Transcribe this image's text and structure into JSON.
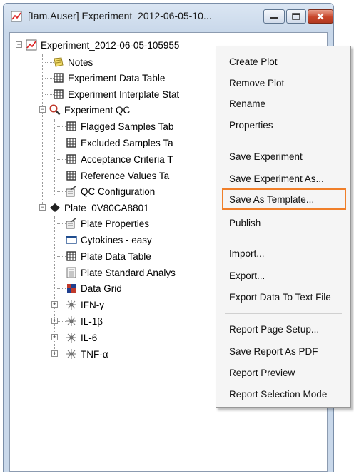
{
  "window": {
    "title": "[Iam.Auser] Experiment_2012-06-05-10..."
  },
  "tree": {
    "root": "Experiment_2012-06-05-105955",
    "items": [
      {
        "label": "Notes",
        "icon": "notes-icon"
      },
      {
        "label": "Experiment Data Table",
        "icon": "table-icon"
      },
      {
        "label": "Experiment Interplate Stat",
        "icon": "table-icon"
      },
      {
        "label": "Experiment QC",
        "icon": "magnifier-icon"
      },
      {
        "label": "Flagged Samples Tab",
        "icon": "table-icon"
      },
      {
        "label": "Excluded Samples Ta",
        "icon": "table-icon"
      },
      {
        "label": "Acceptance Criteria T",
        "icon": "table-icon"
      },
      {
        "label": "Reference Values Ta",
        "icon": "table-icon"
      },
      {
        "label": "QC Configuration",
        "icon": "configuration-icon"
      },
      {
        "label": "Plate_0V80CA8801",
        "icon": "plate-icon"
      },
      {
        "label": "Plate Properties",
        "icon": "configuration-icon"
      },
      {
        "label": "Cytokines - easy",
        "icon": "layout-icon"
      },
      {
        "label": "Plate Data Table",
        "icon": "table-icon"
      },
      {
        "label": "Plate Standard Analys",
        "icon": "analysis-icon"
      },
      {
        "label": "Data Grid",
        "icon": "grid-icon"
      },
      {
        "label": "IFN-γ",
        "icon": "analyte-icon"
      },
      {
        "label": "IL-1β",
        "icon": "analyte-icon"
      },
      {
        "label": "IL-6",
        "icon": "analyte-icon"
      },
      {
        "label": "TNF-α",
        "icon": "analyte-icon"
      }
    ]
  },
  "context_menu": {
    "items": [
      "Create Plot",
      "Remove Plot",
      "Rename",
      "Properties",
      "Save Experiment",
      "Save Experiment As...",
      "Save As Template...",
      "Publish",
      "Import...",
      "Export...",
      "Export Data To Text File",
      "Report Page Setup...",
      "Save Report As PDF",
      "Report Preview",
      "Report Selection Mode"
    ],
    "highlighted": "Save As Template...",
    "highlight_color": "#f07f2a"
  }
}
